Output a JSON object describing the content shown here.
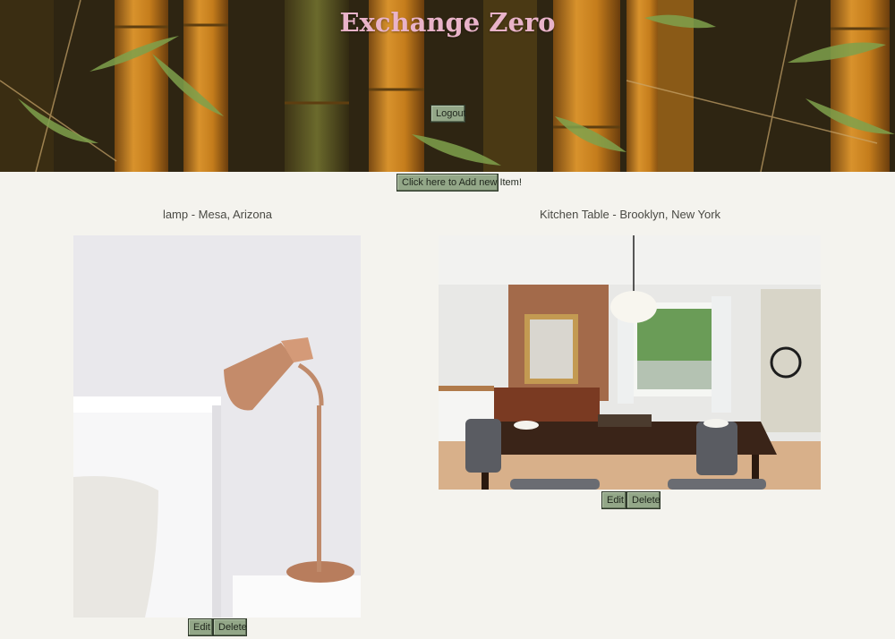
{
  "header": {
    "title": "Exchange Zero",
    "logout_label": "Logout"
  },
  "actions": {
    "add_item_label": "Click here to Add new Item!"
  },
  "items": [
    {
      "title": "lamp - Mesa, Arizona",
      "edit_label": "Edit",
      "delete_label": "Delete"
    },
    {
      "title": "Kitchen Table - Brooklyn, New York",
      "edit_label": "Edit",
      "delete_label": "Delete"
    }
  ],
  "colors": {
    "background": "#f4f3ee",
    "title_pink": "#e9b3c9",
    "button_green": "#93a788"
  }
}
